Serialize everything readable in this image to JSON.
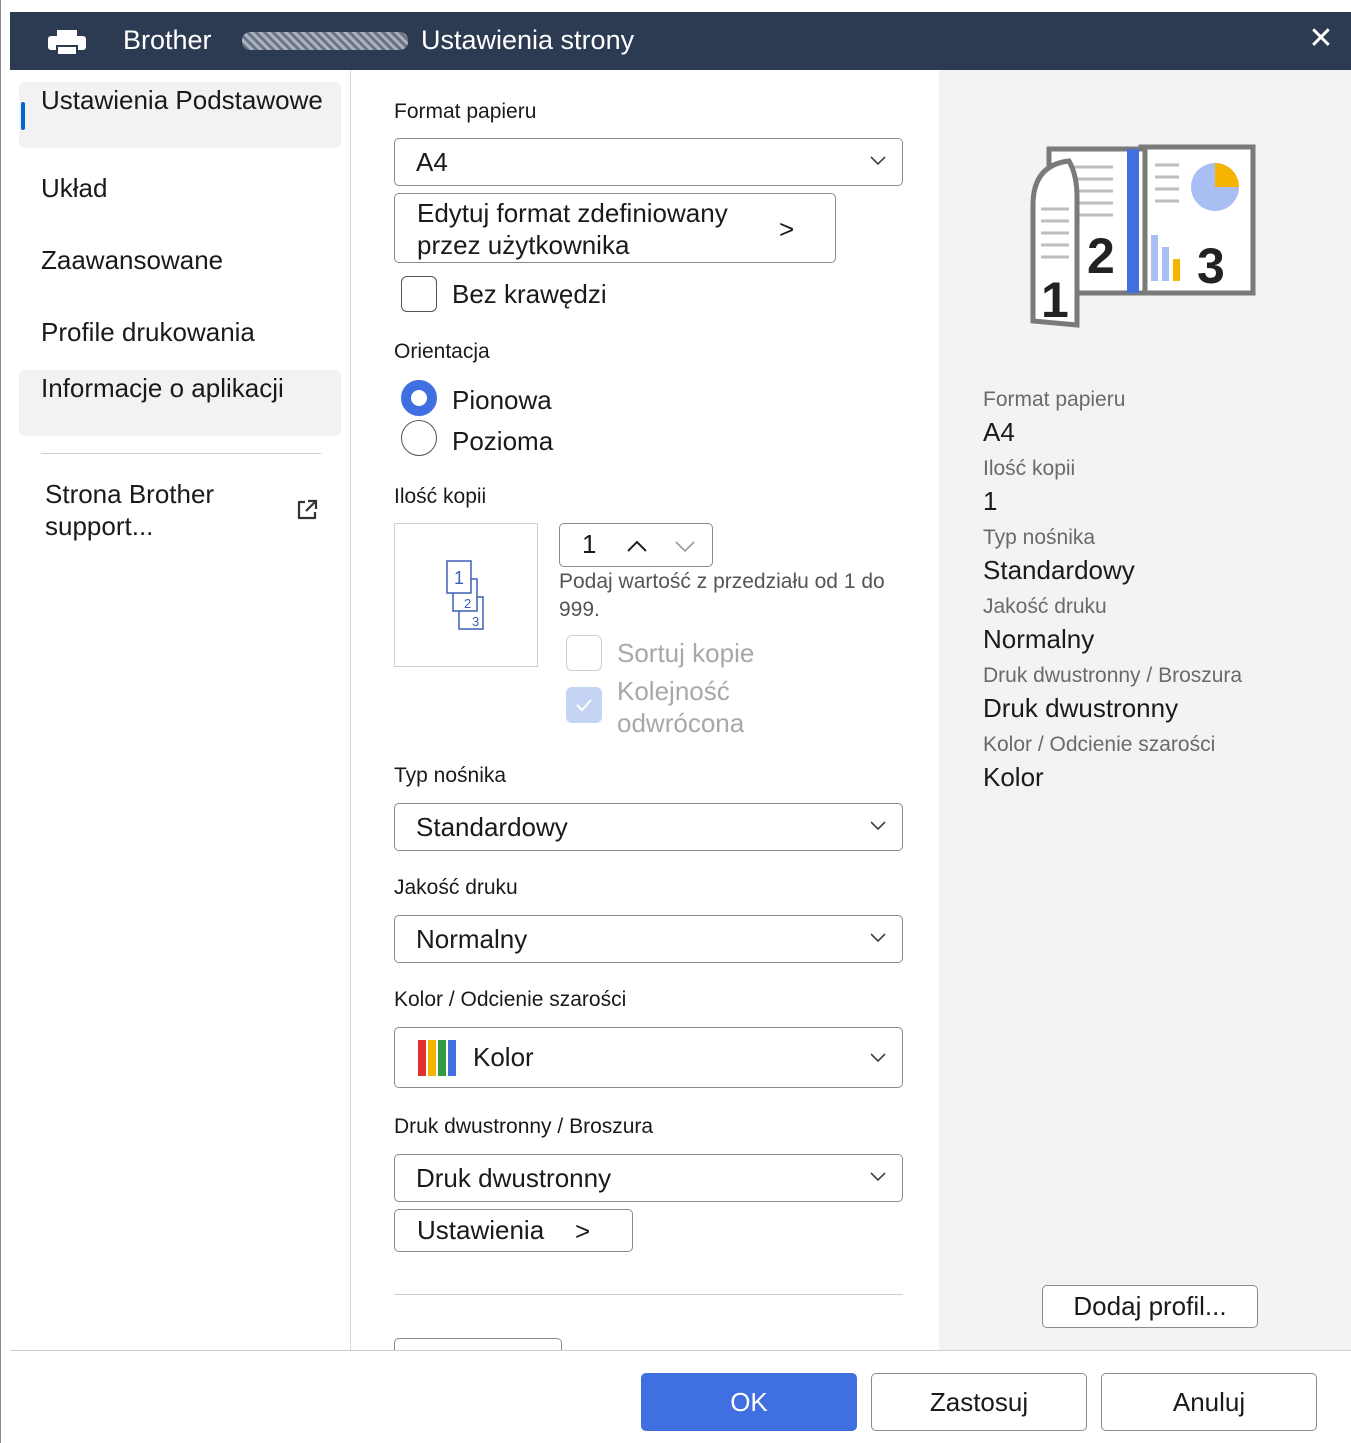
{
  "titlebar": {
    "brand": "Brother",
    "title": "Ustawienia strony",
    "close_glyph": "✕"
  },
  "nav": {
    "items": [
      {
        "label": "Ustawienia Podstawowe",
        "active": true
      },
      {
        "label": "Układ"
      },
      {
        "label": "Zaawansowane"
      },
      {
        "label": "Profile drukowania"
      },
      {
        "label": "Informacje o aplikacji"
      }
    ],
    "support_link": "Strona Brother support..."
  },
  "form": {
    "paper_size": {
      "label": "Format papieru",
      "value": "A4"
    },
    "edit_custom_button": "Edytuj format zdefiniowany przez użytkownika",
    "button_arrow": ">",
    "borderless": {
      "label": "Bez krawędzi",
      "checked": false
    },
    "orientation": {
      "label": "Orientacja",
      "options": [
        {
          "label": "Pionowa",
          "selected": true
        },
        {
          "label": "Pozioma",
          "selected": false
        }
      ]
    },
    "copies": {
      "label": "Ilość kopii",
      "value": "1",
      "hint": "Podaj wartość z przedziału od 1 do 999.",
      "collate": {
        "label": "Sortuj kopie",
        "checked": false,
        "disabled": true
      },
      "reverse": {
        "label": "Kolejność odwrócona",
        "checked": true,
        "disabled": true
      },
      "preview_pages": [
        "1",
        "2",
        "3"
      ]
    },
    "media_type": {
      "label": "Typ nośnika",
      "value": "Standardowy"
    },
    "print_quality": {
      "label": "Jakość druku",
      "value": "Normalny"
    },
    "color": {
      "label": "Kolor / Odcienie szarości",
      "value": "Kolor"
    },
    "duplex": {
      "label": "Druk dwustronny / Broszura",
      "value": "Druk dwustronny"
    },
    "duplex_settings_button": "Ustawienia"
  },
  "summary": {
    "illustration_pages": [
      "1",
      "2",
      "3"
    ],
    "rows": [
      {
        "label": "Format papieru",
        "value": "A4"
      },
      {
        "label": "Ilość kopii",
        "value": "1"
      },
      {
        "label": "Typ nośnika",
        "value": "Standardowy"
      },
      {
        "label": "Jakość druku",
        "value": "Normalny"
      },
      {
        "label": "Druk dwustronny / Broszura",
        "value": "Druk dwustronny"
      },
      {
        "label": "Kolor / Odcienie szarości",
        "value": "Kolor"
      }
    ],
    "add_profile_button": "Dodaj profil..."
  },
  "footer": {
    "ok": "OK",
    "apply": "Zastosuj",
    "cancel": "Anuluj"
  },
  "colors": {
    "titlebar_bg": "#2c3a52",
    "accent": "#3f6fe0",
    "nav_indicator": "#0066cc",
    "summary_bg": "#f3f3f3"
  }
}
